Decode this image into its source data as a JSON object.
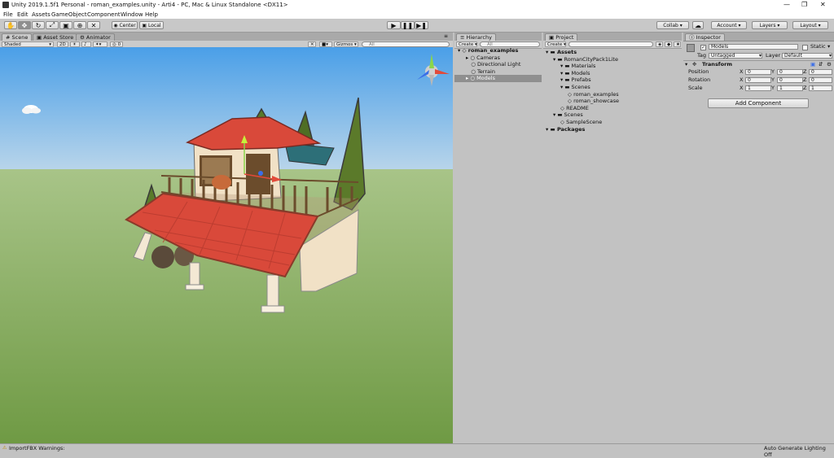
{
  "window": {
    "title": "Unity 2019.1.5f1 Personal - roman_examples.unity - Arti4 - PC, Mac & Linux Standalone <DX11>"
  },
  "menu": [
    "File",
    "Edit",
    "Assets",
    "GameObject",
    "Component",
    "Window",
    "Help"
  ],
  "toolbar": {
    "center_label": "Center",
    "local_label": "Local",
    "collab_label": "Collab ▾",
    "account_label": "Account ▾",
    "layers_label": "Layers",
    "layout_label": "Layout"
  },
  "scene": {
    "tabs": [
      "Scene",
      "Asset Store",
      "Animator"
    ],
    "shading": "Shaded",
    "mode_2d": "2D",
    "fx_count": "0",
    "gizmos_label": "Gizmos ▾",
    "search_placeholder": "All"
  },
  "hierarchy": {
    "tab": "Hierarchy",
    "create_label": "Create ▾",
    "search_placeholder": "All",
    "scene_name": "roman_examples",
    "items": [
      "Cameras",
      "Directional Light",
      "Terrain",
      "Models"
    ]
  },
  "project": {
    "tab": "Project",
    "create_label": "Create ▾",
    "items": [
      {
        "label": "Assets",
        "depth": 0,
        "bold": true
      },
      {
        "label": "RomanCityPack1Lite",
        "depth": 1,
        "bold": false
      },
      {
        "label": "Materials",
        "depth": 2,
        "bold": false
      },
      {
        "label": "Models",
        "depth": 2,
        "bold": false
      },
      {
        "label": "Prefabs",
        "depth": 2,
        "bold": false
      },
      {
        "label": "Scenes",
        "depth": 2,
        "bold": false
      },
      {
        "label": "roman_examples",
        "depth": 3,
        "bold": false
      },
      {
        "label": "roman_showcase",
        "depth": 3,
        "bold": false
      },
      {
        "label": "README",
        "depth": 2,
        "bold": false
      },
      {
        "label": "Scenes",
        "depth": 1,
        "bold": false
      },
      {
        "label": "SampleScene",
        "depth": 2,
        "bold": false
      },
      {
        "label": "Packages",
        "depth": 0,
        "bold": true
      }
    ]
  },
  "inspector": {
    "tab": "Inspector",
    "object_name": "Models",
    "static_label": "Static",
    "tag_label": "Tag",
    "tag_value": "Untagged",
    "layer_label": "Layer",
    "layer_value": "Default",
    "transform_label": "Transform",
    "rows": [
      {
        "label": "Position",
        "x": "0",
        "y": "0",
        "z": "0"
      },
      {
        "label": "Rotation",
        "x": "0",
        "y": "0",
        "z": "0"
      },
      {
        "label": "Scale",
        "x": "1",
        "y": "1",
        "z": "1"
      }
    ],
    "axis_x": "X",
    "axis_y": "Y",
    "axis_z": "Z",
    "add_component": "Add Component"
  },
  "status": {
    "left": "ImportFBX Warnings:",
    "right": "Auto Generate Lighting Off"
  },
  "colors": {
    "selection": "#8f8f8f",
    "sky_top": "#4a9fe8",
    "ground": "#7ea84f",
    "roof": "#d9493a"
  }
}
